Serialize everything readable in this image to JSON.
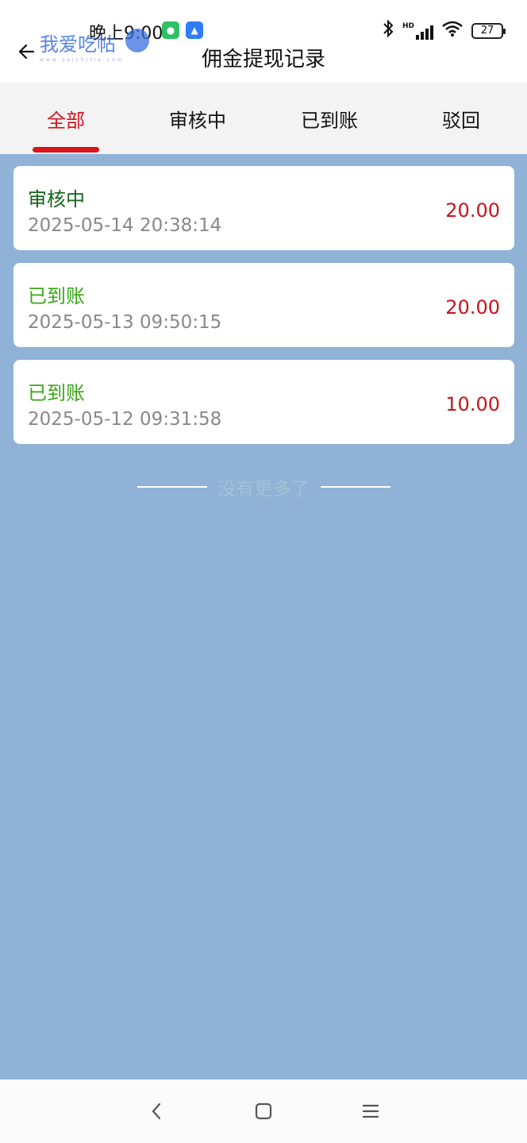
{
  "status_bar": {
    "time": "晚上9:00",
    "battery": "27",
    "network": "HD"
  },
  "watermark": {
    "text": "我爱吃帖",
    "subtext": "www.zaichitie.com"
  },
  "header": {
    "title": "佣金提现记录"
  },
  "tabs": [
    {
      "label": "全部",
      "active": true
    },
    {
      "label": "审核中",
      "active": false
    },
    {
      "label": "已到账",
      "active": false
    },
    {
      "label": "驳回",
      "active": false
    }
  ],
  "records": [
    {
      "status": "审核中",
      "time": "2025-05-14 20:38:14",
      "amount": "20.00",
      "status_color": "#14631a"
    },
    {
      "status": "已到账",
      "time": "2025-05-13 09:50:15",
      "amount": "20.00",
      "status_color": "#3aa617"
    },
    {
      "status": "已到账",
      "time": "2025-05-12 09:31:58",
      "amount": "10.00",
      "status_color": "#3aa617"
    }
  ],
  "end_marker": "没有更多了",
  "colors": {
    "accent": "#d9121b",
    "background": "#8fb2d6",
    "amount": "#c8141c"
  },
  "icons": {
    "back": "arrow-left-icon",
    "nav_back": "chevron-left-icon",
    "nav_home": "square-icon",
    "nav_menu": "menu-icon"
  }
}
